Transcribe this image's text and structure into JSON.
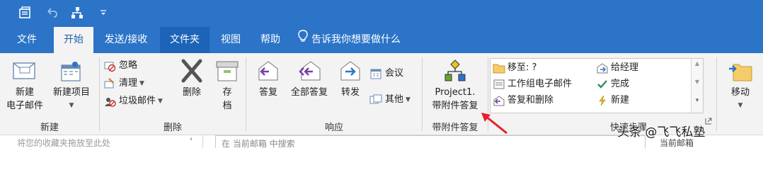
{
  "tabs": [
    "文件",
    "开始",
    "发送/接收",
    "文件夹",
    "视图",
    "帮助"
  ],
  "tell_me": "告诉我你想要做什么",
  "groups": {
    "new": {
      "label": "新建",
      "new_email": [
        "新建",
        "电子邮件"
      ],
      "new_items": [
        "新建项目"
      ]
    },
    "delete": {
      "label": "删除",
      "ignore": "忽略",
      "cleanup": "清理",
      "junk": "垃圾邮件",
      "delete": "删除",
      "archive": [
        "存",
        "档"
      ]
    },
    "respond": {
      "label": "响应",
      "reply": "答复",
      "reply_all": "全部答复",
      "forward": "转发",
      "meeting": "会议",
      "more": "其他"
    },
    "addin": {
      "label": "带附件答复",
      "button": [
        "Project1.",
        "带附件答复"
      ]
    },
    "quicksteps": {
      "label": "快速步骤",
      "items": [
        "移至: ?",
        "工作组电子邮件",
        "答复和删除",
        "给经理",
        "完成",
        "新建"
      ]
    },
    "move": {
      "label": "移动"
    }
  },
  "bottom": {
    "favorites_hint": "将您的收藏夹拖放至此处",
    "search_placeholder": "在 当前邮箱 中搜索",
    "mailbox_scope": "当前邮箱"
  },
  "watermark": "头条 @飞飞私塾",
  "colors": {
    "titlebar": "#2b74c7",
    "ribbon_bg": "#f3f3f3",
    "active_tab_text": "#1f5fae",
    "annotation_arrow": "#e8202a"
  }
}
